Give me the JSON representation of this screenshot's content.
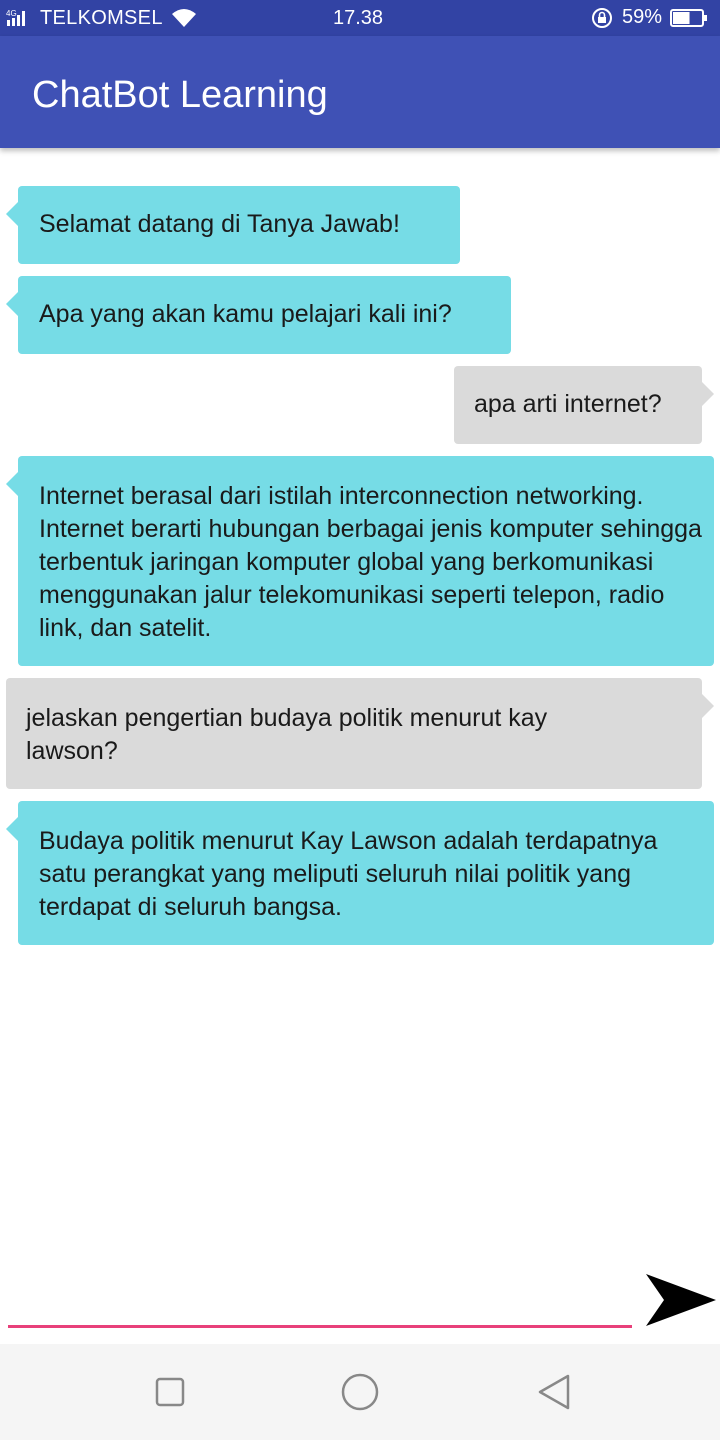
{
  "status_bar": {
    "network_type": "4G",
    "carrier": "TELKOMSEL",
    "time": "17.38",
    "battery_percent": "59%",
    "battery_level": 0.59,
    "icons": [
      "signal-icon",
      "wifi-icon",
      "rotation-lock-icon",
      "battery-icon"
    ]
  },
  "app_bar": {
    "title": "ChatBot Learning"
  },
  "colors": {
    "status_bar": "#3243a4",
    "app_bar": "#3f51b5",
    "bot_bubble": "#76dce6",
    "user_bubble": "#dadada",
    "input_underline": "#e8407a"
  },
  "messages": [
    {
      "sender": "bot",
      "text": "Selamat datang di Tanya Jawab!"
    },
    {
      "sender": "bot",
      "text": "Apa yang akan kamu pelajari kali ini?"
    },
    {
      "sender": "user",
      "text": "apa arti internet?"
    },
    {
      "sender": "bot",
      "text": "Internet berasal dari istilah interconnection networking. Internet berarti hubungan berbagai jenis komputer sehingga terbentuk jaringan komputer global yang berkomunikasi menggunakan jalur telekomunikasi seperti telepon, radio link, dan satelit."
    },
    {
      "sender": "user",
      "text": "jelaskan pengertian budaya politik menurut kay lawson?"
    },
    {
      "sender": "bot",
      "text": "Budaya politik menurut Kay Lawson adalah terdapatnya satu perangkat yang meliputi seluruh nilai politik yang terdapat di seluruh bangsa."
    }
  ],
  "input": {
    "value": "",
    "send_icon": "send-icon"
  },
  "nav_bar": {
    "icons": [
      "recents-icon",
      "home-icon",
      "back-icon"
    ]
  }
}
